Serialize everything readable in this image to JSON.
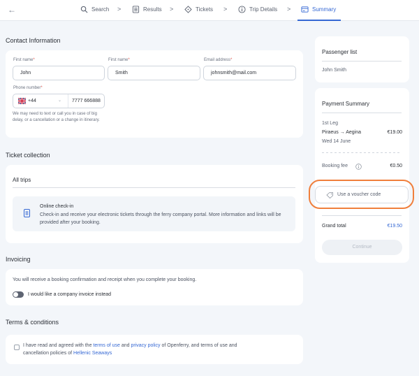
{
  "nav": {
    "back_icon": "arrow-left-icon",
    "steps": [
      {
        "label": "Search",
        "icon": "search-icon"
      },
      {
        "label": "Results",
        "icon": "list-icon"
      },
      {
        "label": "Tickets",
        "icon": "ticket-icon"
      },
      {
        "label": "Trip Details",
        "icon": "info-icon"
      },
      {
        "label": "Summary",
        "icon": "card-icon",
        "active": true
      }
    ],
    "accent": "#3568d4"
  },
  "contact": {
    "heading": "Contact Information",
    "first_name_label": "First name",
    "first_name_value": "John",
    "last_name_label": "First name",
    "last_name_value": "Smith",
    "email_label": "Email address",
    "email_value": "johnsmith@mail.com",
    "phone_label": "Phone number",
    "phone_code": "+44",
    "phone_value": "7777 666888",
    "phone_note": "We may need to text or call you in case of big delay, or a cancellation or a change in itinerary.",
    "required_mark": "*"
  },
  "tickets": {
    "heading": "Ticket collection",
    "section_title": "All trips",
    "option_title": "Online check-in",
    "option_text": "Check-in and receive your electronic tickets through the ferry company portal. More information and links will be provided after your booking."
  },
  "invoicing": {
    "heading": "Invoicing",
    "text": "You will receive a booking confirmation and receipt when you complete your booking.",
    "toggle_label": "I would like a company invoice instead"
  },
  "terms": {
    "heading": "Terms & conditions",
    "text_1": "I have read and agreed with the ",
    "link_1": "terms of use",
    "text_2": " and ",
    "link_2": "privacy policy",
    "text_3": " of Openferry, and terms of use and",
    "text_4": "cancellation policies of ",
    "link_3": "Hellenic Seaways"
  },
  "passengers": {
    "title": "Passenger list",
    "names": [
      "John Smith"
    ]
  },
  "payment": {
    "title": "Payment Summary",
    "leg": "1st Leg",
    "route": "Piraeus → Aegina",
    "route_price": "€19.00",
    "date": "Wed 14 June",
    "fee_label": "Booking fee",
    "fee_price": "€0.50",
    "voucher_label": "Use a voucher code",
    "total_label": "Grand total",
    "total_price": "€19.50",
    "continue_label": "Continue",
    "highlight_color": "#f07f3c"
  }
}
